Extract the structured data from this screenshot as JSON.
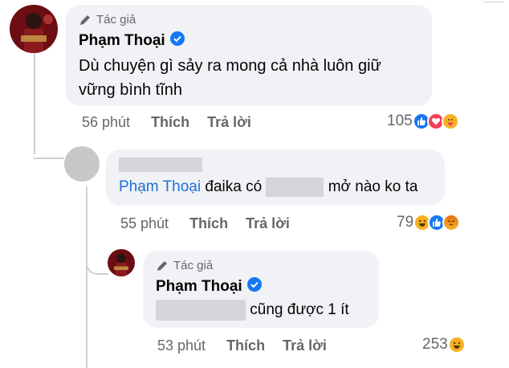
{
  "comments": [
    {
      "author_tag": "Tác giả",
      "name": "Phạm Thoại",
      "text": "Dù chuyện gì sảy ra mong cả nhà luôn giữ vững bình tĩnh",
      "text_line1": "Dù chuyện gì sảy ra mong cả nhà luôn giữ",
      "text_line2": "vững bình tĩnh",
      "time": "56 phút",
      "like_label": "Thích",
      "reply_label": "Trả lời",
      "reaction_count": "105",
      "reactions": [
        "like-icon",
        "love-icon",
        "care-icon"
      ]
    },
    {
      "mention": "Phạm Thoại",
      "text_after_mention": "đaika có",
      "text_end": "mở nào ko ta",
      "time": "55 phút",
      "like_label": "Thích",
      "reply_label": "Trả lời",
      "reaction_count": "79",
      "reactions": [
        "haha-icon",
        "like-icon",
        "angry-icon"
      ]
    },
    {
      "author_tag": "Tác giả",
      "name": "Phạm Thoại",
      "text_end": "cũng được 1 ít",
      "time": "53 phút",
      "like_label": "Thích",
      "reply_label": "Trả lời",
      "reaction_count": "253",
      "reactions": [
        "haha-icon"
      ]
    }
  ],
  "colors": {
    "bubble": "#f0f2f5",
    "meta_text": "#65676b",
    "mention": "#216fdb",
    "verified": "#1877f2",
    "thread_line": "#ced0d4"
  }
}
